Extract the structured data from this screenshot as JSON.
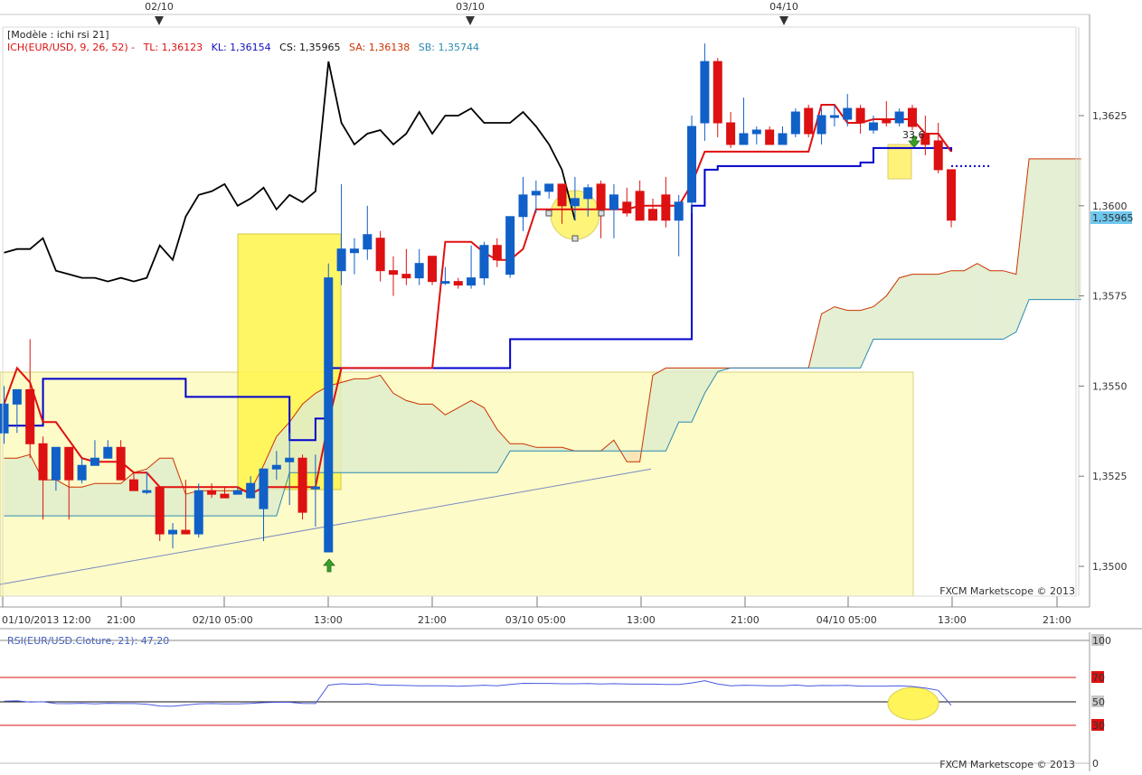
{
  "header": {
    "model_label": "[Modèle : ichi rsi 21]",
    "ich_prefix": "ICH(EUR/USD, 9, 26, 52) -",
    "tl": "TL: 1,36123",
    "kl": "KL: 1,36154",
    "cs": "CS: 1,35965",
    "sa": "SA: 1,36138",
    "sb": "SB: 1,35744"
  },
  "top_dates": [
    "02/10",
    "03/10",
    "04/10"
  ],
  "price_axis": {
    "ticks": [
      "1,3625",
      "1,3600",
      "1,3575",
      "1,3550",
      "1,3525",
      "1,3500"
    ],
    "current": "1,35965"
  },
  "time_axis": [
    "01/10/2013 12:00",
    "21:00",
    "02/10 05:00",
    "13:00",
    "21:00",
    "03/10 05:00",
    "13:00",
    "21:00",
    "04/10 05:00",
    "13:00",
    "21:00"
  ],
  "annotation_value": "33,6",
  "watermark": "FXCM Marketscope © 2013",
  "rsi": {
    "label": "RSI(EUR/USD.Cloture, 21): 47,20",
    "levels": [
      "100",
      "70",
      "50",
      "30",
      "0"
    ]
  },
  "colors": {
    "bull": "#1060c8",
    "bear": "#dd1111",
    "tenkan": "#e01010",
    "kijun": "#0000cc",
    "chikou": "#000000",
    "span_a": "#cc3300",
    "span_b": "#2a8ab0",
    "highlight": "#fff580"
  },
  "chart_data": {
    "type": "candlestick",
    "symbol": "EUR/USD",
    "indicator": "ICH(EUR/USD, 9, 26, 52)",
    "candles": [
      {
        "o": 1.3537,
        "h": 1.355,
        "c": 1.3545,
        "l": 1.3534
      },
      {
        "o": 1.3545,
        "h": 1.3549,
        "c": 1.3549,
        "l": 1.3537
      },
      {
        "o": 1.3549,
        "h": 1.3563,
        "c": 1.3534,
        "l": 1.353
      },
      {
        "o": 1.3534,
        "h": 1.3536,
        "c": 1.3524,
        "l": 1.3513
      },
      {
        "o": 1.3524,
        "h": 1.3533,
        "c": 1.3533,
        "l": 1.3521
      },
      {
        "o": 1.3533,
        "h": 1.3533,
        "c": 1.3524,
        "l": 1.3513
      },
      {
        "o": 1.3524,
        "h": 1.353,
        "c": 1.3528,
        "l": 1.3523
      },
      {
        "o": 1.3528,
        "h": 1.3535,
        "c": 1.353,
        "l": 1.3528
      },
      {
        "o": 1.353,
        "h": 1.3535,
        "c": 1.3533,
        "l": 1.353
      },
      {
        "o": 1.3533,
        "h": 1.3535,
        "c": 1.3524,
        "l": 1.3524
      },
      {
        "o": 1.3524,
        "h": 1.3526,
        "c": 1.3521,
        "l": 1.3521
      },
      {
        "o": 1.3521,
        "h": 1.3526,
        "c": 1.3521,
        "l": 1.352
      },
      {
        "o": 1.3522,
        "h": 1.3522,
        "c": 1.3509,
        "l": 1.3507
      },
      {
        "o": 1.3509,
        "h": 1.3512,
        "c": 1.351,
        "l": 1.3505
      },
      {
        "o": 1.351,
        "h": 1.3524,
        "c": 1.3509,
        "l": 1.3509
      },
      {
        "o": 1.3509,
        "h": 1.3523,
        "c": 1.3521,
        "l": 1.3508
      },
      {
        "o": 1.3521,
        "h": 1.3523,
        "c": 1.352,
        "l": 1.3519
      },
      {
        "o": 1.352,
        "h": 1.3522,
        "c": 1.3519,
        "l": 1.3519
      },
      {
        "o": 1.352,
        "h": 1.3522,
        "c": 1.3521,
        "l": 1.3521
      },
      {
        "o": 1.3519,
        "h": 1.3525,
        "c": 1.3523,
        "l": 1.3519
      },
      {
        "o": 1.3516,
        "h": 1.3527,
        "c": 1.3527,
        "l": 1.3507
      },
      {
        "o": 1.3527,
        "h": 1.3532,
        "c": 1.3528,
        "l": 1.3524
      },
      {
        "o": 1.3529,
        "h": 1.3537,
        "c": 1.353,
        "l": 1.3517
      },
      {
        "o": 1.353,
        "h": 1.3531,
        "c": 1.3515,
        "l": 1.3513
      },
      {
        "o": 1.3522,
        "h": 1.3531,
        "c": 1.3522,
        "l": 1.3511
      },
      {
        "o": 1.3504,
        "h": 1.3584,
        "c": 1.358,
        "l": 1.3504
      },
      {
        "o": 1.3582,
        "h": 1.3606,
        "c": 1.3588,
        "l": 1.3578
      },
      {
        "o": 1.3587,
        "h": 1.3591,
        "c": 1.3588,
        "l": 1.3581
      },
      {
        "o": 1.3588,
        "h": 1.36,
        "c": 1.3592,
        "l": 1.3585
      },
      {
        "o": 1.3591,
        "h": 1.3593,
        "c": 1.3582,
        "l": 1.3579
      },
      {
        "o": 1.3582,
        "h": 1.3586,
        "c": 1.3581,
        "l": 1.3575
      },
      {
        "o": 1.3581,
        "h": 1.3588,
        "c": 1.358,
        "l": 1.3578
      },
      {
        "o": 1.358,
        "h": 1.3588,
        "c": 1.3584,
        "l": 1.3578
      },
      {
        "o": 1.3586,
        "h": 1.3586,
        "c": 1.3579,
        "l": 1.3578
      },
      {
        "o": 1.3579,
        "h": 1.3583,
        "c": 1.3579,
        "l": 1.3578
      },
      {
        "o": 1.3579,
        "h": 1.358,
        "c": 1.3578,
        "l": 1.3577
      },
      {
        "o": 1.3578,
        "h": 1.3589,
        "c": 1.358,
        "l": 1.3577
      },
      {
        "o": 1.358,
        "h": 1.359,
        "c": 1.3589,
        "l": 1.3578
      },
      {
        "o": 1.3589,
        "h": 1.3591,
        "c": 1.3585,
        "l": 1.3583
      },
      {
        "o": 1.3581,
        "h": 1.3597,
        "c": 1.3597,
        "l": 1.358
      },
      {
        "o": 1.3597,
        "h": 1.3608,
        "c": 1.3603,
        "l": 1.3593
      },
      {
        "o": 1.3603,
        "h": 1.3607,
        "c": 1.3604,
        "l": 1.3598
      },
      {
        "o": 1.3604,
        "h": 1.3606,
        "c": 1.3606,
        "l": 1.3602
      },
      {
        "o": 1.3606,
        "h": 1.3606,
        "c": 1.36,
        "l": 1.3595
      },
      {
        "o": 1.36,
        "h": 1.3608,
        "c": 1.3602,
        "l": 1.3596
      },
      {
        "o": 1.3602,
        "h": 1.3606,
        "c": 1.3605,
        "l": 1.3597
      },
      {
        "o": 1.3606,
        "h": 1.3607,
        "c": 1.3599,
        "l": 1.3591
      },
      {
        "o": 1.3599,
        "h": 1.3606,
        "c": 1.3603,
        "l": 1.3591
      },
      {
        "o": 1.3601,
        "h": 1.3605,
        "c": 1.3598,
        "l": 1.3597
      },
      {
        "o": 1.3604,
        "h": 1.3607,
        "c": 1.3596,
        "l": 1.3596
      },
      {
        "o": 1.3599,
        "h": 1.3602,
        "c": 1.3596,
        "l": 1.3596
      },
      {
        "o": 1.3603,
        "h": 1.3608,
        "c": 1.3596,
        "l": 1.3594
      },
      {
        "o": 1.3596,
        "h": 1.3603,
        "c": 1.3601,
        "l": 1.3586
      },
      {
        "o": 1.3601,
        "h": 1.3625,
        "c": 1.3622,
        "l": 1.3598
      },
      {
        "o": 1.3623,
        "h": 1.3645,
        "c": 1.364,
        "l": 1.3618
      },
      {
        "o": 1.364,
        "h": 1.3641,
        "c": 1.3623,
        "l": 1.3619
      },
      {
        "o": 1.3623,
        "h": 1.3626,
        "c": 1.3617,
        "l": 1.3616
      },
      {
        "o": 1.3617,
        "h": 1.363,
        "c": 1.362,
        "l": 1.3617
      },
      {
        "o": 1.362,
        "h": 1.3622,
        "c": 1.3621,
        "l": 1.3617
      },
      {
        "o": 1.3621,
        "h": 1.3622,
        "c": 1.3617,
        "l": 1.3617
      },
      {
        "o": 1.3617,
        "h": 1.3622,
        "c": 1.362,
        "l": 1.3617
      },
      {
        "o": 1.362,
        "h": 1.3627,
        "c": 1.3626,
        "l": 1.3619
      },
      {
        "o": 1.3627,
        "h": 1.3628,
        "c": 1.362,
        "l": 1.3619
      },
      {
        "o": 1.362,
        "h": 1.3627,
        "c": 1.3625,
        "l": 1.3617
      },
      {
        "o": 1.3625,
        "h": 1.3628,
        "c": 1.3625,
        "l": 1.3622
      },
      {
        "o": 1.3624,
        "h": 1.3631,
        "c": 1.3627,
        "l": 1.3622
      },
      {
        "o": 1.3627,
        "h": 1.3628,
        "c": 1.3623,
        "l": 1.362
      },
      {
        "o": 1.3621,
        "h": 1.3625,
        "c": 1.3623,
        "l": 1.362
      },
      {
        "o": 1.3624,
        "h": 1.3629,
        "c": 1.3623,
        "l": 1.3622
      },
      {
        "o": 1.3623,
        "h": 1.3627,
        "c": 1.3626,
        "l": 1.3622
      },
      {
        "o": 1.3627,
        "h": 1.3628,
        "c": 1.3622,
        "l": 1.3621
      },
      {
        "o": 1.362,
        "h": 1.3625,
        "c": 1.3617,
        "l": 1.3614
      },
      {
        "o": 1.3618,
        "h": 1.3623,
        "c": 1.361,
        "l": 1.3609
      },
      {
        "o": 1.361,
        "h": 1.361,
        "c": 1.3596,
        "l": 1.3594
      }
    ],
    "tenkan": [
      [
        1.3545,
        1.3555,
        1.3551,
        1.354,
        1.354,
        1.3535,
        1.353,
        1.3529,
        1.3529,
        1.3529,
        1.3526,
        1.3526,
        1.3522,
        1.3522,
        1.3522,
        1.3522,
        1.3522,
        1.3522,
        1.3522,
        1.352,
        1.3522,
        1.3522,
        1.3522,
        1.3522,
        1.3522,
        1.354,
        1.3555,
        1.3555,
        1.3555,
        1.3555,
        1.3555,
        1.3555,
        1.3555,
        1.3555,
        1.359,
        1.359,
        1.359,
        1.3587,
        1.3585,
        1.3585,
        1.3588,
        1.3599,
        1.3599,
        1.3599,
        1.3599,
        1.3599,
        1.3599,
        1.3599,
        1.3599,
        1.36,
        1.36,
        1.36,
        1.36,
        1.3606,
        1.3615,
        1.3615,
        1.3615,
        1.3615,
        1.3615,
        1.3615,
        1.3615,
        1.3615,
        1.3615,
        1.3628,
        1.3628,
        1.3623,
        1.3623,
        1.3624,
        1.3624,
        1.3624,
        1.3624,
        1.362,
        1.362,
        1.3615
      ]
    ],
    "kijun": [
      1.3539,
      1.3539,
      1.3539,
      1.3552,
      1.3552,
      1.3552,
      1.3552,
      1.3552,
      1.3552,
      1.3552,
      1.3552,
      1.3552,
      1.3552,
      1.3552,
      1.3547,
      1.3547,
      1.3547,
      1.3547,
      1.3547,
      1.3547,
      1.3547,
      1.3547,
      1.3535,
      1.3535,
      1.3541,
      1.3555,
      1.3555,
      1.3555,
      1.3555,
      1.3555,
      1.3555,
      1.3555,
      1.3555,
      1.3555,
      1.3555,
      1.3555,
      1.3555,
      1.3555,
      1.3555,
      1.3563,
      1.3563,
      1.3563,
      1.3563,
      1.3563,
      1.3563,
      1.3563,
      1.3563,
      1.3563,
      1.3563,
      1.3563,
      1.3563,
      1.3563,
      1.3563,
      1.36,
      1.361,
      1.3611,
      1.3611,
      1.3611,
      1.3611,
      1.3611,
      1.3611,
      1.3611,
      1.3611,
      1.3611,
      1.3611,
      1.3611,
      1.3612,
      1.3616,
      1.3616,
      1.3616,
      1.3616,
      1.3616,
      1.3616,
      1.3615
    ],
    "chikou": [
      1.3587,
      1.3588,
      1.3588,
      1.3591,
      1.3582,
      1.3581,
      1.358,
      1.358,
      1.3579,
      1.358,
      1.3579,
      1.358,
      1.3589,
      1.3585,
      1.3597,
      1.3603,
      1.3604,
      1.3606,
      1.36,
      1.3602,
      1.3605,
      1.3599,
      1.3603,
      1.3601,
      1.3604,
      1.364,
      1.3623,
      1.3617,
      1.362,
      1.3621,
      1.3617,
      1.362,
      1.3626,
      1.362,
      1.3625,
      1.3625,
      1.3627,
      1.3623,
      1.3623,
      1.3623,
      1.3626,
      1.3622,
      1.3617,
      1.361,
      1.3596
    ],
    "span_a": [
      1.353,
      1.353,
      1.3531,
      1.3524,
      1.3524,
      1.3522,
      1.3522,
      1.3523,
      1.3523,
      1.3523,
      1.3526,
      1.3527,
      1.353,
      1.353,
      1.352,
      1.3521,
      1.3521,
      1.3521,
      1.3521,
      1.3521,
      1.3528,
      1.3536,
      1.354,
      1.3545,
      1.3548,
      1.355,
      1.3551,
      1.3552,
      1.3552,
      1.3553,
      1.3548,
      1.3546,
      1.3545,
      1.3545,
      1.3542,
      1.3544,
      1.3546,
      1.3544,
      1.3538,
      1.3534,
      1.3534,
      1.3533,
      1.3533,
      1.3533,
      1.3532,
      1.3532,
      1.3532,
      1.3535,
      1.3529,
      1.3529,
      1.3553,
      1.3555,
      1.3555,
      1.3555,
      1.3555,
      1.3555,
      1.3555,
      1.3555,
      1.3555,
      1.3555,
      1.3555,
      1.3555,
      1.3555,
      1.357,
      1.3572,
      1.3571,
      1.3571,
      1.3572,
      1.3575,
      1.358,
      1.3581,
      1.3581,
      1.3581,
      1.3582,
      1.3582,
      1.3584,
      1.3582,
      1.3582,
      1.3581,
      1.3613,
      1.3613,
      1.3613,
      1.3613,
      1.3613
    ],
    "span_b": [
      1.3514,
      1.3514,
      1.3514,
      1.3514,
      1.3514,
      1.3514,
      1.3514,
      1.3514,
      1.3514,
      1.3514,
      1.3514,
      1.3514,
      1.3514,
      1.3514,
      1.3514,
      1.3514,
      1.3514,
      1.3514,
      1.3514,
      1.3514,
      1.3514,
      1.3514,
      1.3526,
      1.3526,
      1.3526,
      1.3526,
      1.3526,
      1.3526,
      1.3526,
      1.3526,
      1.3526,
      1.3526,
      1.3526,
      1.3526,
      1.3526,
      1.3526,
      1.3526,
      1.3526,
      1.3526,
      1.3532,
      1.3532,
      1.3532,
      1.3532,
      1.3532,
      1.3532,
      1.3532,
      1.3532,
      1.3532,
      1.3532,
      1.3532,
      1.3532,
      1.3532,
      1.354,
      1.354,
      1.3548,
      1.3554,
      1.3555,
      1.3555,
      1.3555,
      1.3555,
      1.3555,
      1.3555,
      1.3555,
      1.3555,
      1.3555,
      1.3555,
      1.3555,
      1.3563,
      1.3563,
      1.3563,
      1.3563,
      1.3563,
      1.3563,
      1.3563,
      1.3563,
      1.3563,
      1.3563,
      1.3563,
      1.3565,
      1.3574,
      1.3574,
      1.3574,
      1.3574,
      1.3574
    ],
    "rsi_values": [
      50.5,
      50.8,
      49.8,
      50.1,
      48.6,
      48.5,
      48.8,
      48.4,
      48.8,
      48.6,
      48.6,
      48.1,
      46.6,
      46.4,
      47.4,
      48.4,
      48.6,
      48.4,
      48.3,
      48.7,
      49.3,
      49.6,
      49.6,
      48.7,
      48.6,
      63.7,
      64.8,
      64.4,
      64.8,
      63.8,
      63.6,
      63.4,
      63.2,
      63.1,
      63.2,
      62.8,
      63.1,
      63.6,
      63.1,
      64.2,
      65.2,
      65.1,
      65.1,
      64.8,
      64.8,
      65.0,
      64.6,
      64.9,
      64.7,
      64.5,
      64.5,
      64.3,
      64.3,
      65.5,
      67.3,
      64.7,
      63.2,
      63.6,
      63.4,
      63.1,
      63.2,
      63.8,
      63.0,
      63.4,
      63.3,
      63.5,
      62.9,
      62.9,
      62.9,
      63.2,
      62.6,
      61.3,
      59.4,
      47.2
    ],
    "rsi_period": 21,
    "rsi_current": 47.2,
    "rsi_levels": [
      100,
      70,
      50,
      30,
      0
    ],
    "trendline": {
      "from": 1.3495,
      "to": 1.3527
    },
    "ylim": [
      1.3492,
      1.3648
    ],
    "grid": false,
    "legend": "top-left"
  }
}
